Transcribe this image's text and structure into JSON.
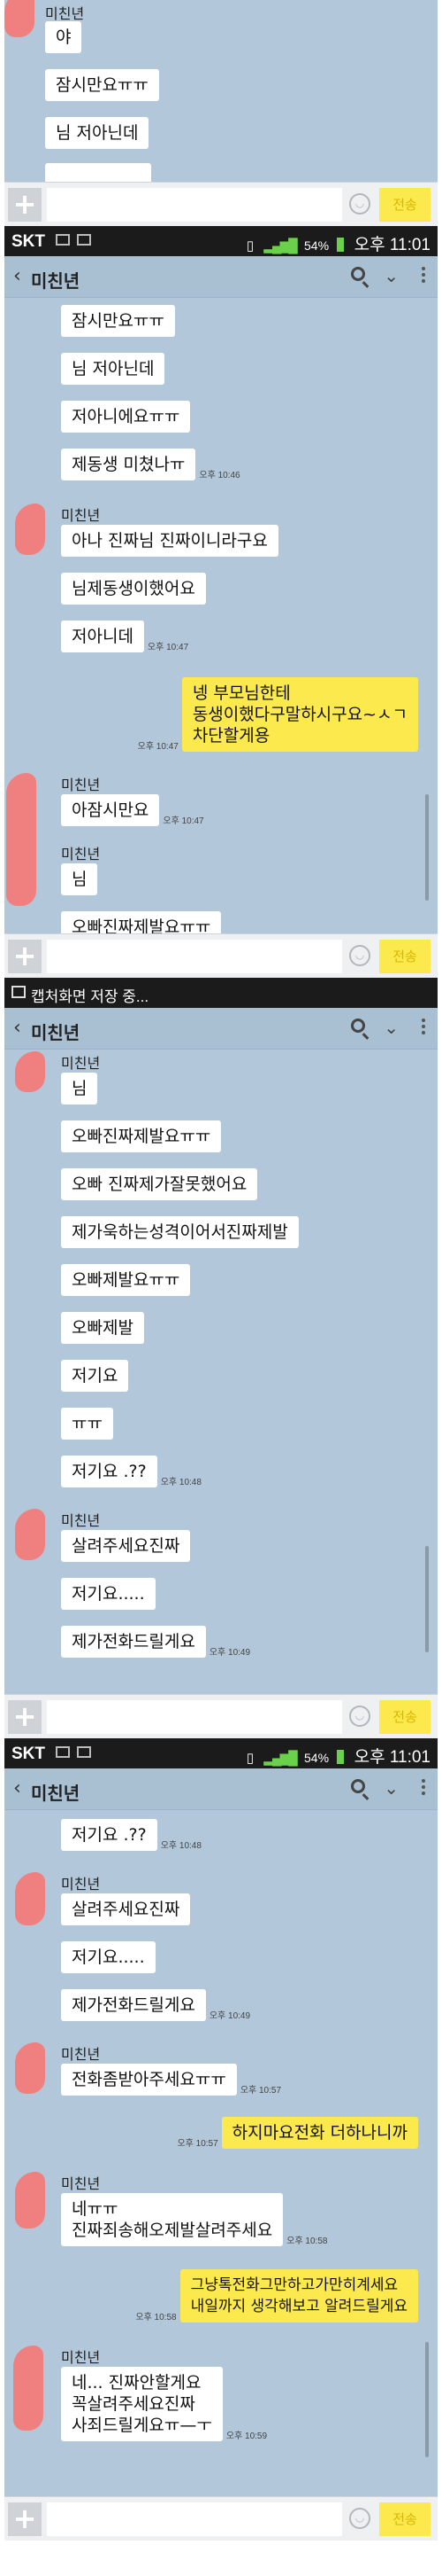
{
  "status_bar": {
    "carrier": "SKT",
    "battery": "54%",
    "time": "오후 11:01",
    "capture_notice": "캡처화면 저장 중..."
  },
  "chat": {
    "title": "미친년",
    "sender": "미친년"
  },
  "input": {
    "send_label": "전송"
  },
  "colors": {
    "background": "#b2c7d9",
    "my_bubble": "#fce94d",
    "their_bubble": "#ffffff",
    "send_button": "#fce94d"
  },
  "panels": [
    {
      "messages": [
        {
          "text": "야",
          "time": ""
        },
        {
          "text": "잠시만요ㅠㅠ",
          "time": ""
        },
        {
          "text": "님 저아닌데",
          "time": ""
        }
      ]
    },
    {
      "messages": [
        {
          "text": "잠시만요ㅠㅠ",
          "time": ""
        },
        {
          "text": "님 저아닌데",
          "time": ""
        },
        {
          "text": "저아니에요ㅠㅠ",
          "time": ""
        },
        {
          "text": "제동생 미쳤나ㅠ",
          "time": "오후 10:46"
        },
        {
          "text": "아나 진짜님 진짜이니라구요",
          "time": ""
        },
        {
          "text": "님제동생이했어요",
          "time": ""
        },
        {
          "text": "저아니데",
          "time": "오후 10:47"
        },
        {
          "text": "넹 부모님한테\n동생이했다구말하시구요~ㅅㄱ\n차단할게용",
          "time": "오후 10:47"
        },
        {
          "text": "아잠시만요",
          "time": "오후 10:47"
        },
        {
          "text": "님",
          "time": ""
        },
        {
          "text": "오빠진짜제발요ㅠㅠ",
          "time": ""
        }
      ]
    },
    {
      "messages": [
        {
          "text": "님",
          "time": ""
        },
        {
          "text": "오빠진짜제발요ㅠㅠ",
          "time": ""
        },
        {
          "text": "오빠 진짜제가잘못했어요",
          "time": ""
        },
        {
          "text": "제가욱하는성격이어서진짜제발",
          "time": ""
        },
        {
          "text": "오빠제발요ㅠㅠ",
          "time": ""
        },
        {
          "text": "오빠제발",
          "time": ""
        },
        {
          "text": "저기요",
          "time": ""
        },
        {
          "text": "ㅠㅠ",
          "time": ""
        },
        {
          "text": "저기요 .??",
          "time": "오후 10:48"
        },
        {
          "text": "살려주세요진짜",
          "time": ""
        },
        {
          "text": "저기요.....",
          "time": ""
        },
        {
          "text": "제가전화드릴게요",
          "time": "오후 10:49"
        }
      ]
    },
    {
      "messages": [
        {
          "text": "저기요 .??",
          "time": "오후 10:48"
        },
        {
          "text": "살려주세요진짜",
          "time": ""
        },
        {
          "text": "저기요.....",
          "time": ""
        },
        {
          "text": "제가전화드릴게요",
          "time": "오후 10:49"
        },
        {
          "text": "전화좀받아주세요ㅠㅠ",
          "time": "오후 10:57"
        },
        {
          "text": "하지마요전화 더하나니까",
          "time": "오후 10:57"
        },
        {
          "text": "네ㅠㅠ\n진짜죄송해오제발살려주세요",
          "time": "오후 10:58"
        },
        {
          "text": "그냥톡전화그만하고가만히계세요\n내일까지 생각해보고 알려드릴게요",
          "time": "오후 10:58"
        },
        {
          "text": "네... 진짜안할게요\n꼭살려주세요진짜\n사죄드릴게요ㅠ—ㅜ",
          "time": "오후 10:59"
        }
      ]
    }
  ]
}
